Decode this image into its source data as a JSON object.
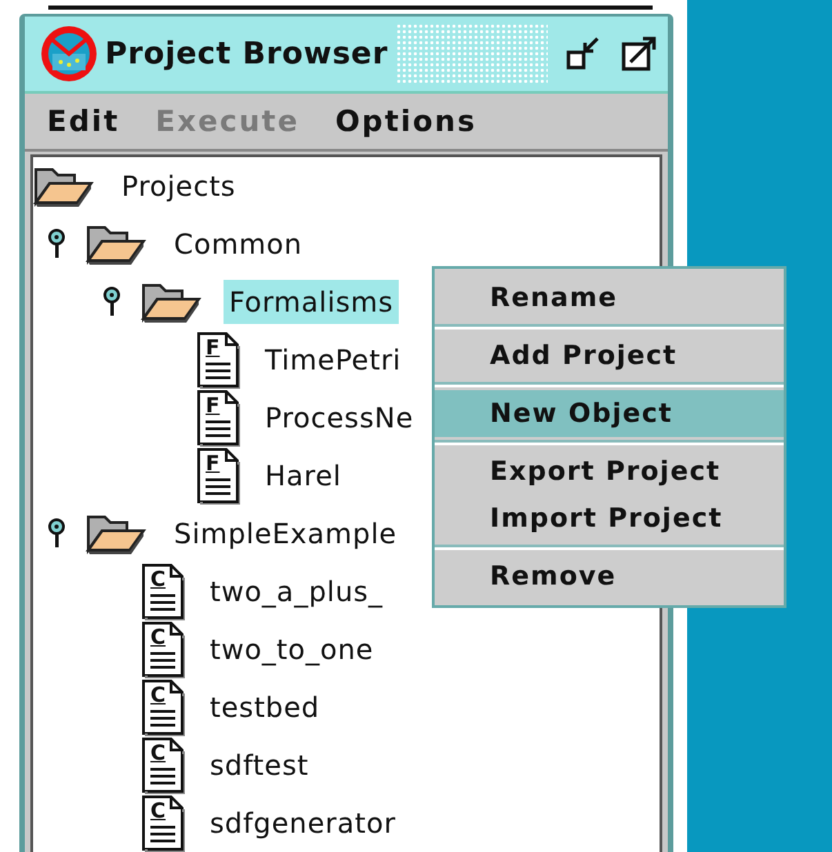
{
  "window": {
    "title": "Project Browser"
  },
  "menu_bar": [
    {
      "label": "Edit",
      "disabled": false
    },
    {
      "label": "Execute",
      "disabled": true
    },
    {
      "label": "Options",
      "disabled": false
    }
  ],
  "tree": [
    {
      "kind": "folder",
      "label": "Projects",
      "selected": false,
      "children": [
        {
          "kind": "folder",
          "label": "Common",
          "expanded": true,
          "selected": false,
          "children": [
            {
              "kind": "folder",
              "label": "Formalisms",
              "expanded": true,
              "selected": true,
              "children": [
                {
                  "kind": "file",
                  "icon_letter": "F",
                  "label": "TimePetri",
                  "selected": false
                },
                {
                  "kind": "file",
                  "icon_letter": "F",
                  "label": "ProcessNe",
                  "selected": false
                },
                {
                  "kind": "file",
                  "icon_letter": "F",
                  "label": "Harel",
                  "selected": false
                }
              ]
            }
          ]
        },
        {
          "kind": "folder",
          "label": "SimpleExample",
          "expanded": true,
          "selected": false,
          "children": [
            {
              "kind": "file",
              "icon_letter": "C",
              "label": "two_a_plus_",
              "selected": false
            },
            {
              "kind": "file",
              "icon_letter": "C",
              "label": "two_to_one",
              "selected": false
            },
            {
              "kind": "file",
              "icon_letter": "C",
              "label": "testbed",
              "selected": false
            },
            {
              "kind": "file",
              "icon_letter": "C",
              "label": "sdftest",
              "selected": false
            },
            {
              "kind": "file",
              "icon_letter": "C",
              "label": "sdfgenerator",
              "selected": false
            }
          ]
        }
      ]
    }
  ],
  "context_menu": [
    {
      "label": "Rename",
      "selected": false,
      "separator_after": true
    },
    {
      "label": "Add Project",
      "selected": false,
      "separator_after": true
    },
    {
      "label": "New Object",
      "selected": true,
      "separator_after": true
    },
    {
      "label": "Export Project",
      "selected": false,
      "separator_after": false
    },
    {
      "label": "Import Project",
      "selected": false,
      "separator_after": true
    },
    {
      "label": "Remove",
      "selected": false,
      "separator_after": false
    }
  ]
}
